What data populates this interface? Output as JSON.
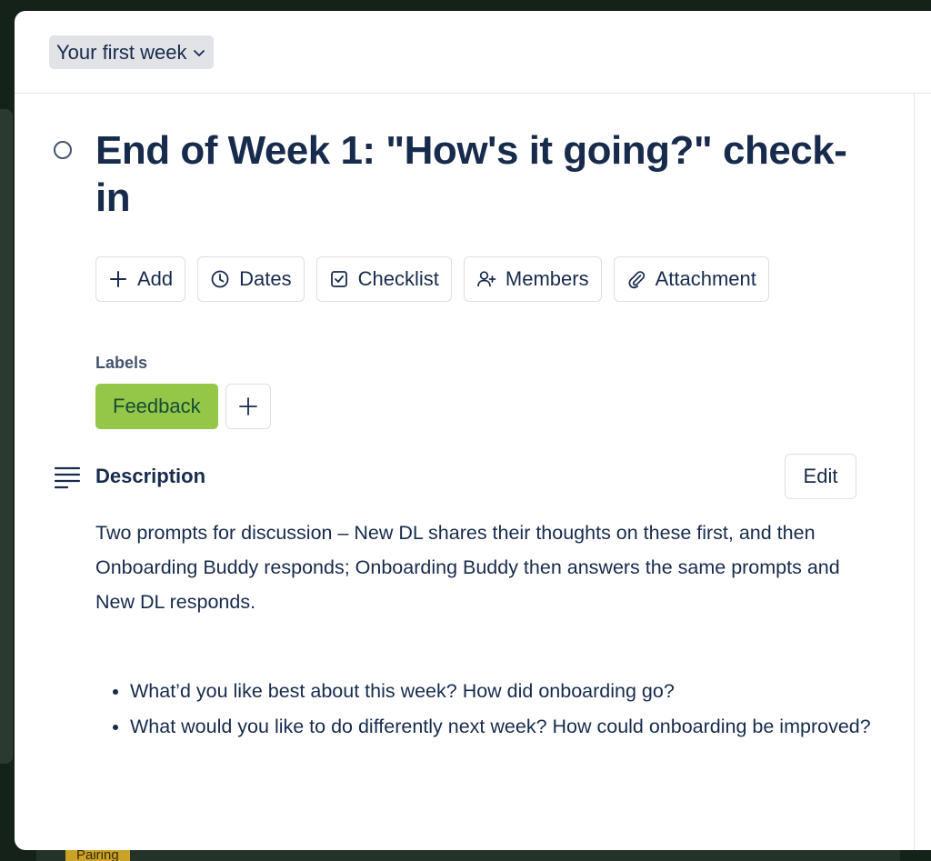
{
  "list_selector": {
    "label": "Your first week"
  },
  "background": {
    "badge": "Pairing"
  },
  "card": {
    "title": "End of Week 1: \"How's it going?\" check-in",
    "actions": [
      {
        "icon": "plus-icon",
        "label": "Add"
      },
      {
        "icon": "clock-icon",
        "label": "Dates"
      },
      {
        "icon": "checkbox-icon",
        "label": "Checklist"
      },
      {
        "icon": "add-member-icon",
        "label": "Members"
      },
      {
        "icon": "paperclip-icon",
        "label": "Attachment"
      }
    ],
    "labels_heading": "Labels",
    "labels": [
      {
        "text": "Feedback",
        "color": "#94c748"
      }
    ],
    "description_heading": "Description",
    "edit_label": "Edit",
    "description": "Two prompts for discussion – New DL shares their thoughts on these first, and then Onboarding Buddy responds; Onboarding Buddy then answers the same prompts and New DL responds.",
    "prompts": [
      "What’d you like best about this week? How did onboarding go?",
      "What would you like to do differently next week? How could onboarding be improved?"
    ]
  }
}
